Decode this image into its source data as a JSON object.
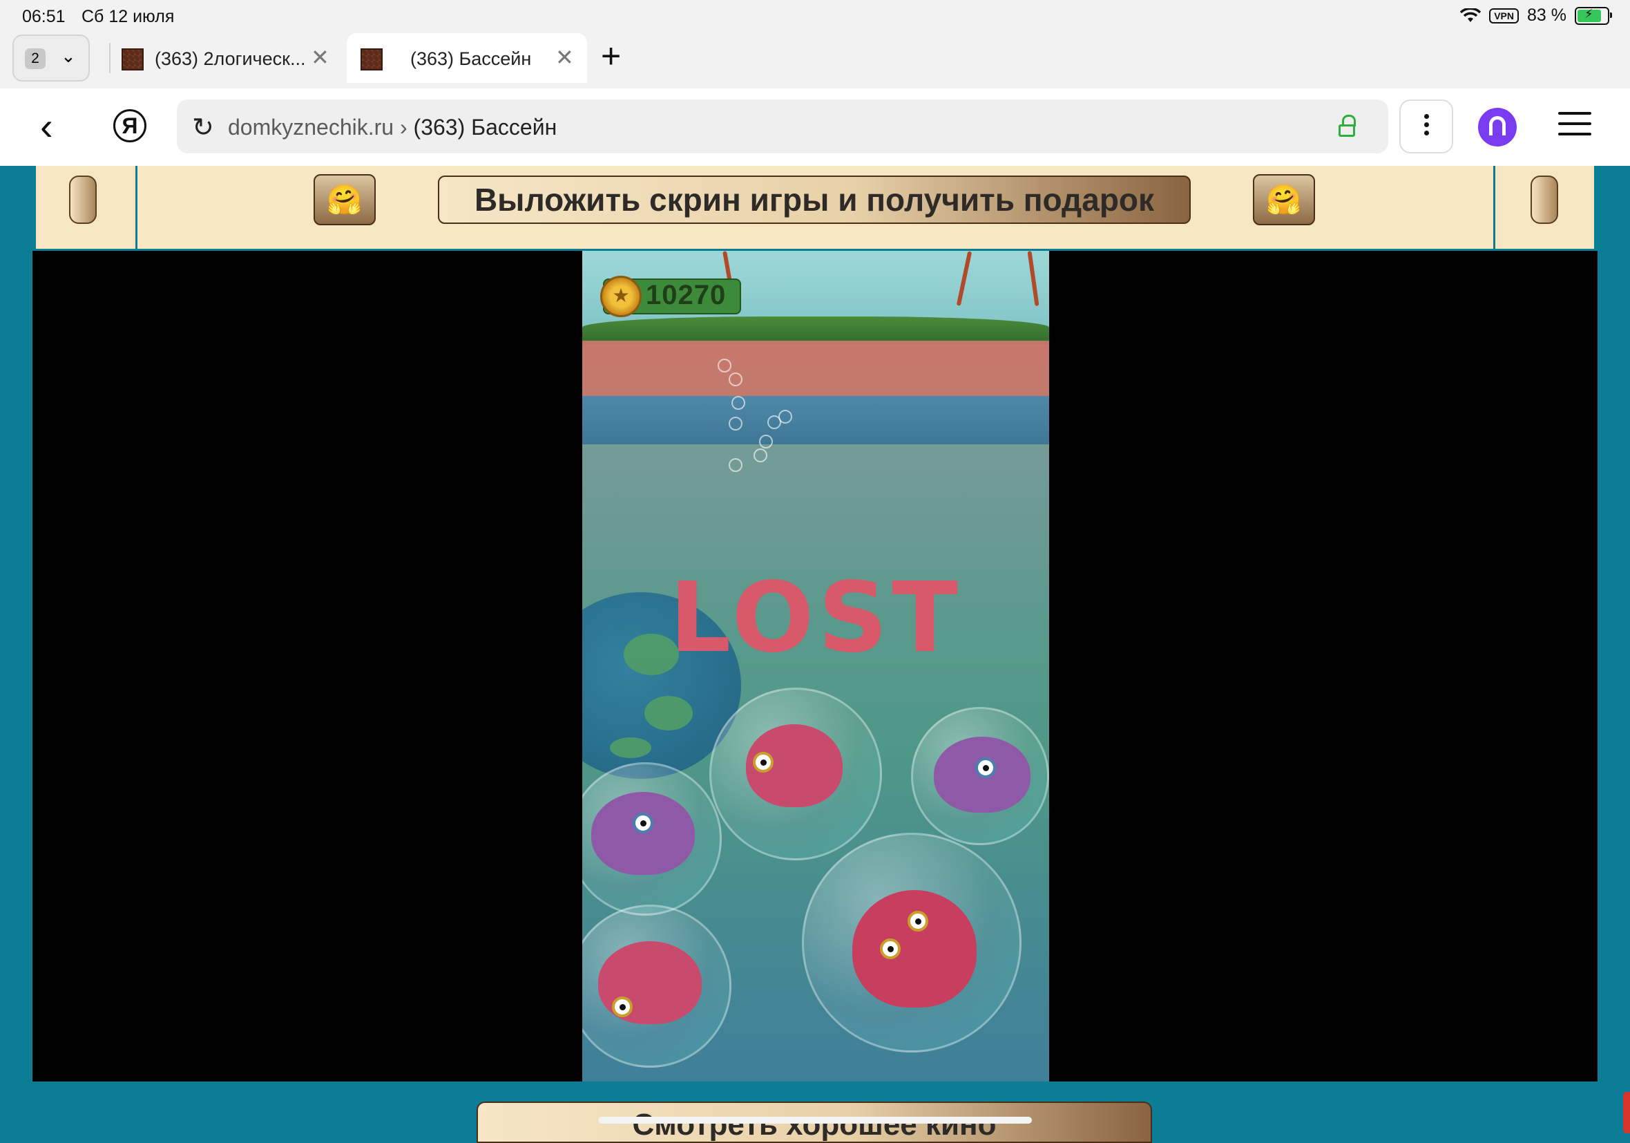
{
  "status_bar": {
    "time": "06:51",
    "date": "Сб 12 июля",
    "vpn": "VPN",
    "battery": "83 %"
  },
  "tabs": {
    "count": "2",
    "items": [
      {
        "title": "(363) 2логическ...",
        "active": false
      },
      {
        "title": "(363) Бассейн",
        "active": true
      }
    ]
  },
  "address_bar": {
    "host": "domkyznechik.ru",
    "separator": " › ",
    "page": "(363) Бассейн"
  },
  "page": {
    "promo_label": "Выложить скрин игры и получить подарок",
    "promo_emoji": "🤗",
    "bottom_button": "Смотреть хорошее кино"
  },
  "game": {
    "score": "10270",
    "status": "LOST"
  },
  "colors": {
    "page_bg": "#0b7d96",
    "promo_bg": "#f7e6c2",
    "lost_text": "#d8596a",
    "alice": "#7a3cf0",
    "lock": "#2eae3c"
  }
}
